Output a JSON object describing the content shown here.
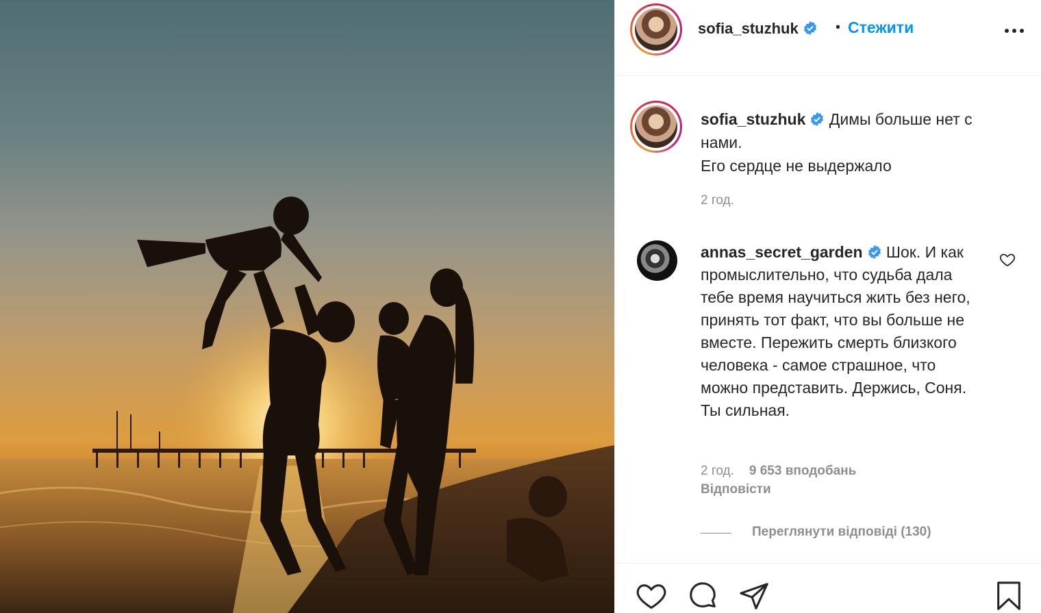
{
  "post": {
    "photo_alt": "family-silhouette-sunset-beach"
  },
  "header": {
    "username": "sofia_stuzhuk",
    "separator": "•",
    "follow_label": "Стежити"
  },
  "caption": {
    "username": "sofia_stuzhuk",
    "text_line1": "Димы больше нет с нами.",
    "text_line2": "Его сердце не выдержало",
    "time": "2 год."
  },
  "comment": {
    "username": "annas_secret_garden",
    "text": "Шок. И как промыслительно, что судьба дала тебе время научиться жить без него, принять тот факт, что вы больше не вместе. Пережить смерть близкого человека - самое страшное, что можно представить. Держись, Соня. Ты сильная.",
    "time": "2 год.",
    "likes": "9 653 вподобань",
    "reply_label": "Відповісти",
    "view_replies": "Переглянути відповіді (130)"
  },
  "icons": {
    "verified": "verified-badge-icon",
    "more": "more-options-icon",
    "heart": "heart-icon",
    "comment": "comment-icon",
    "share": "share-icon",
    "save": "bookmark-icon"
  },
  "colors": {
    "accent": "#0095f6",
    "verified": "#3897f0",
    "text": "#262626",
    "muted": "#8e8e8e"
  }
}
